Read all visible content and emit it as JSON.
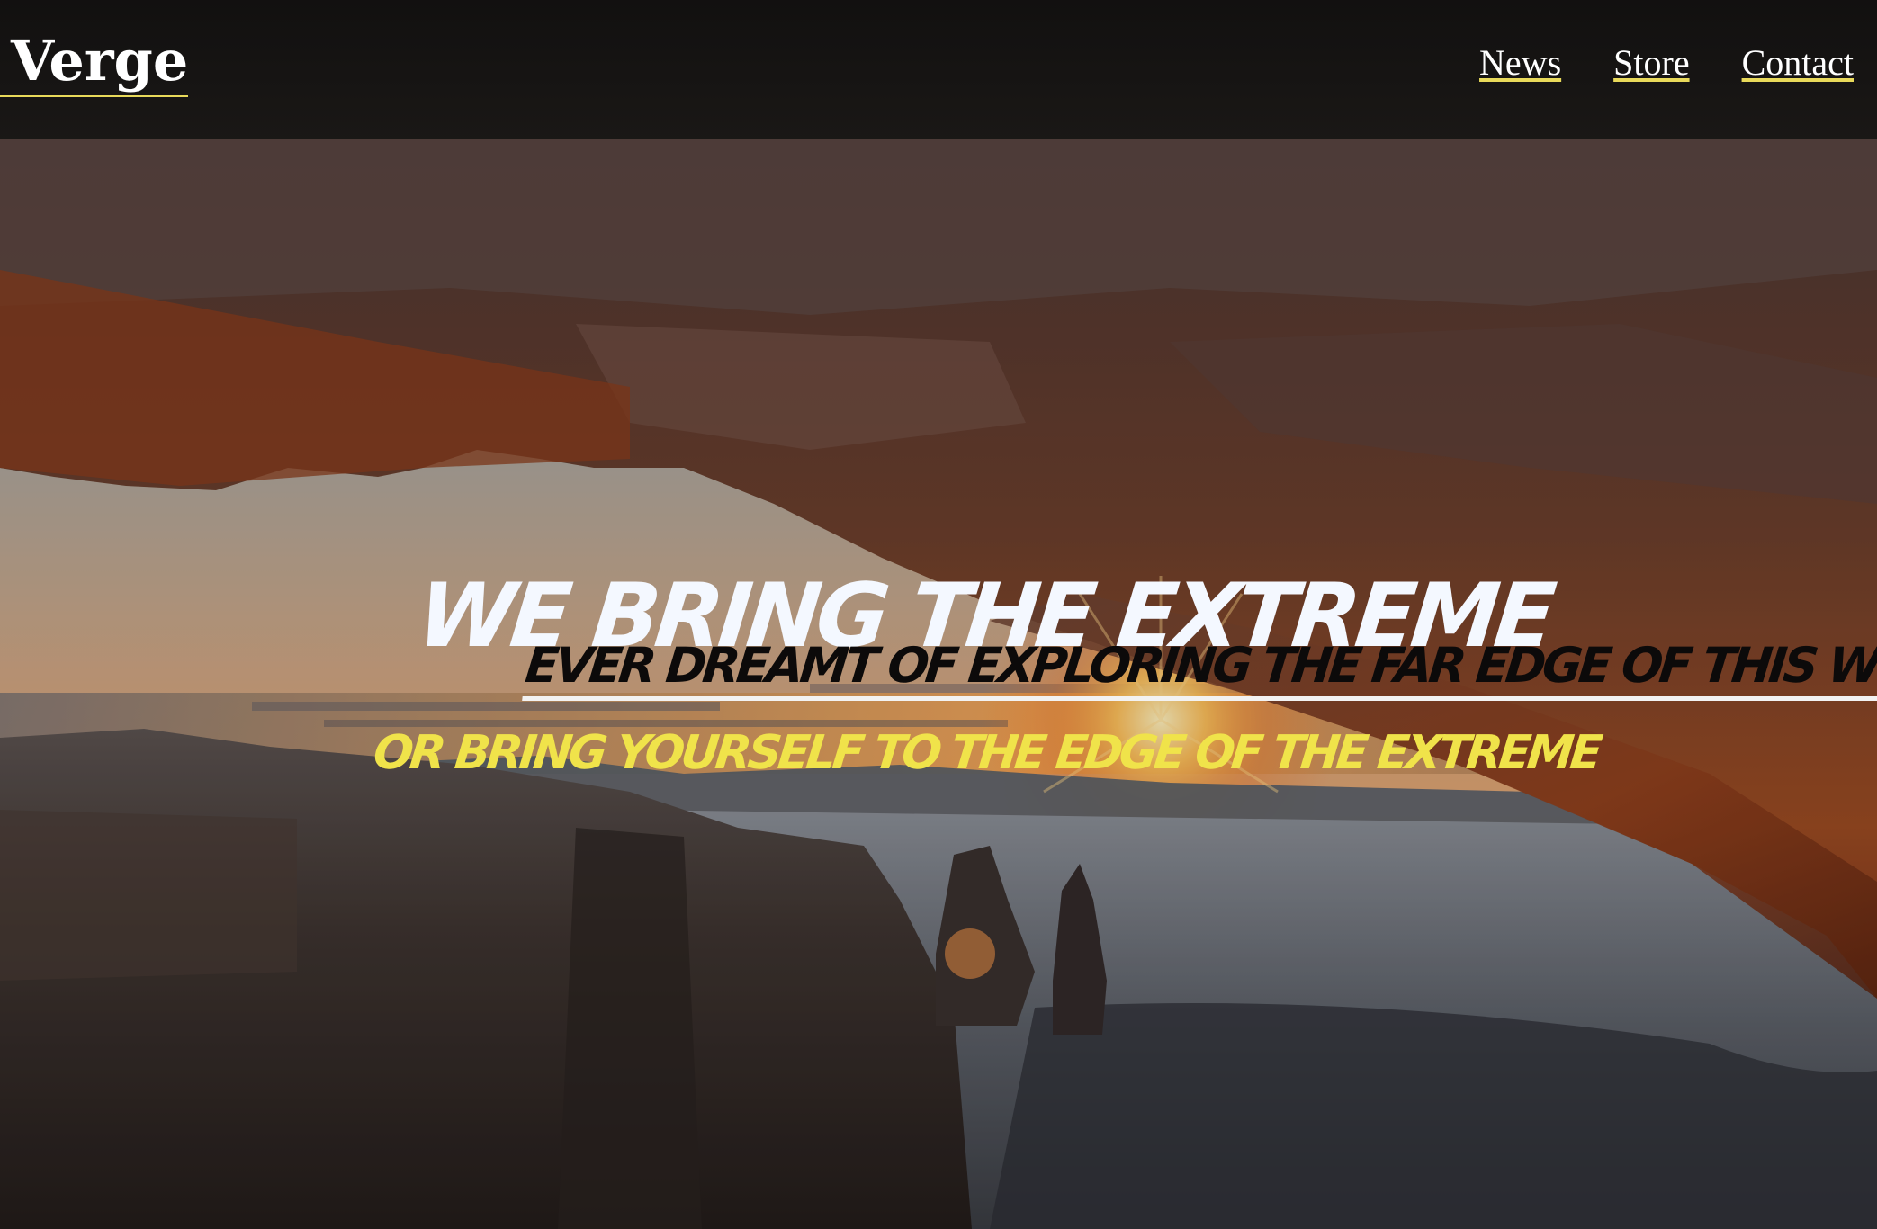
{
  "navbar": {
    "brand": "Verge",
    "links": [
      "News",
      "Store",
      "Contact"
    ]
  },
  "hero": {
    "title": "We Bring The Extreme",
    "subtitle": "Ever dreamt of exploring the far edge of this world",
    "tagline": "or bring yourself to the edge of the extreme",
    "background": "canyon-arch-sunrise-photo"
  },
  "colors": {
    "accent": "#e8d95a",
    "tagline": "#f0e34a",
    "title": "#f4f8ff",
    "navbar": "#121010"
  }
}
